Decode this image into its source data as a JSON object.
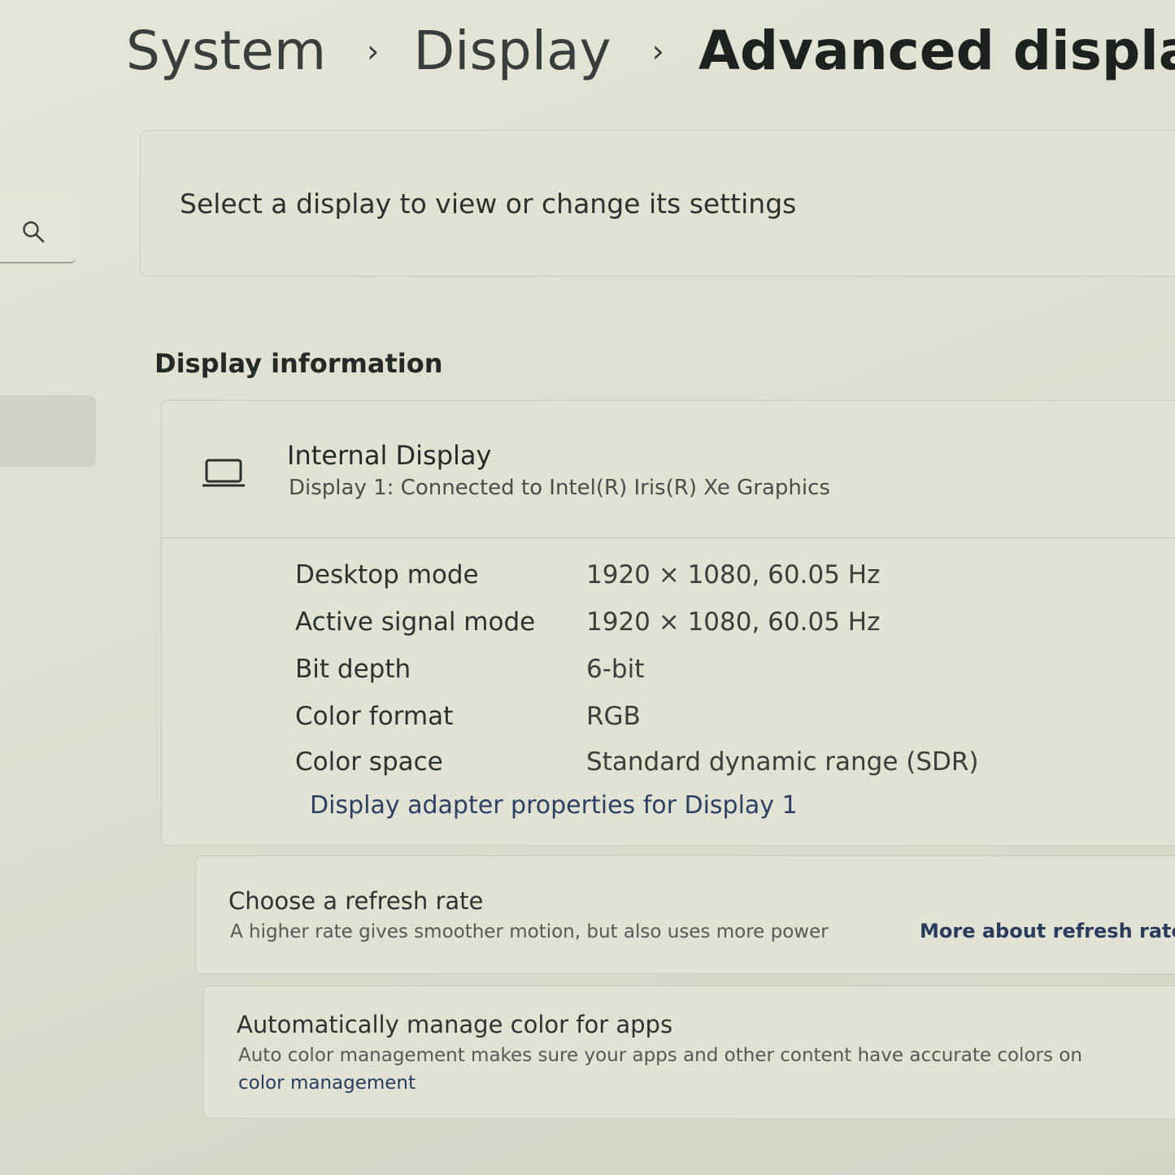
{
  "breadcrumb": {
    "items": [
      "System",
      "Display",
      "Advanced displa"
    ],
    "separator": "›"
  },
  "search": {
    "icon": "search-icon"
  },
  "select_display": {
    "text": "Select a display to view or change its settings"
  },
  "display_information": {
    "heading": "Display information",
    "display_name": "Internal Display",
    "display_subtitle": "Display 1: Connected to Intel(R) Iris(R) Xe Graphics",
    "icon": "laptop-icon",
    "rows": [
      {
        "label": "Desktop mode",
        "value": "1920 × 1080, 60.05 Hz"
      },
      {
        "label": "Active signal mode",
        "value": "1920 × 1080, 60.05 Hz"
      },
      {
        "label": "Bit depth",
        "value": "6-bit"
      },
      {
        "label": "Color format",
        "value": "RGB"
      },
      {
        "label": "Color space",
        "value": "Standard dynamic range (SDR)"
      }
    ],
    "adapter_link": "Display adapter properties for Display 1"
  },
  "refresh_rate": {
    "title": "Choose a refresh rate",
    "description": "A higher rate gives smoother motion, but also uses more power",
    "link": "More about refresh rate"
  },
  "color_management": {
    "title": "Automatically manage color for apps",
    "description": "Auto color management makes sure your apps and other content have accurate colors on",
    "link": "color management"
  }
}
